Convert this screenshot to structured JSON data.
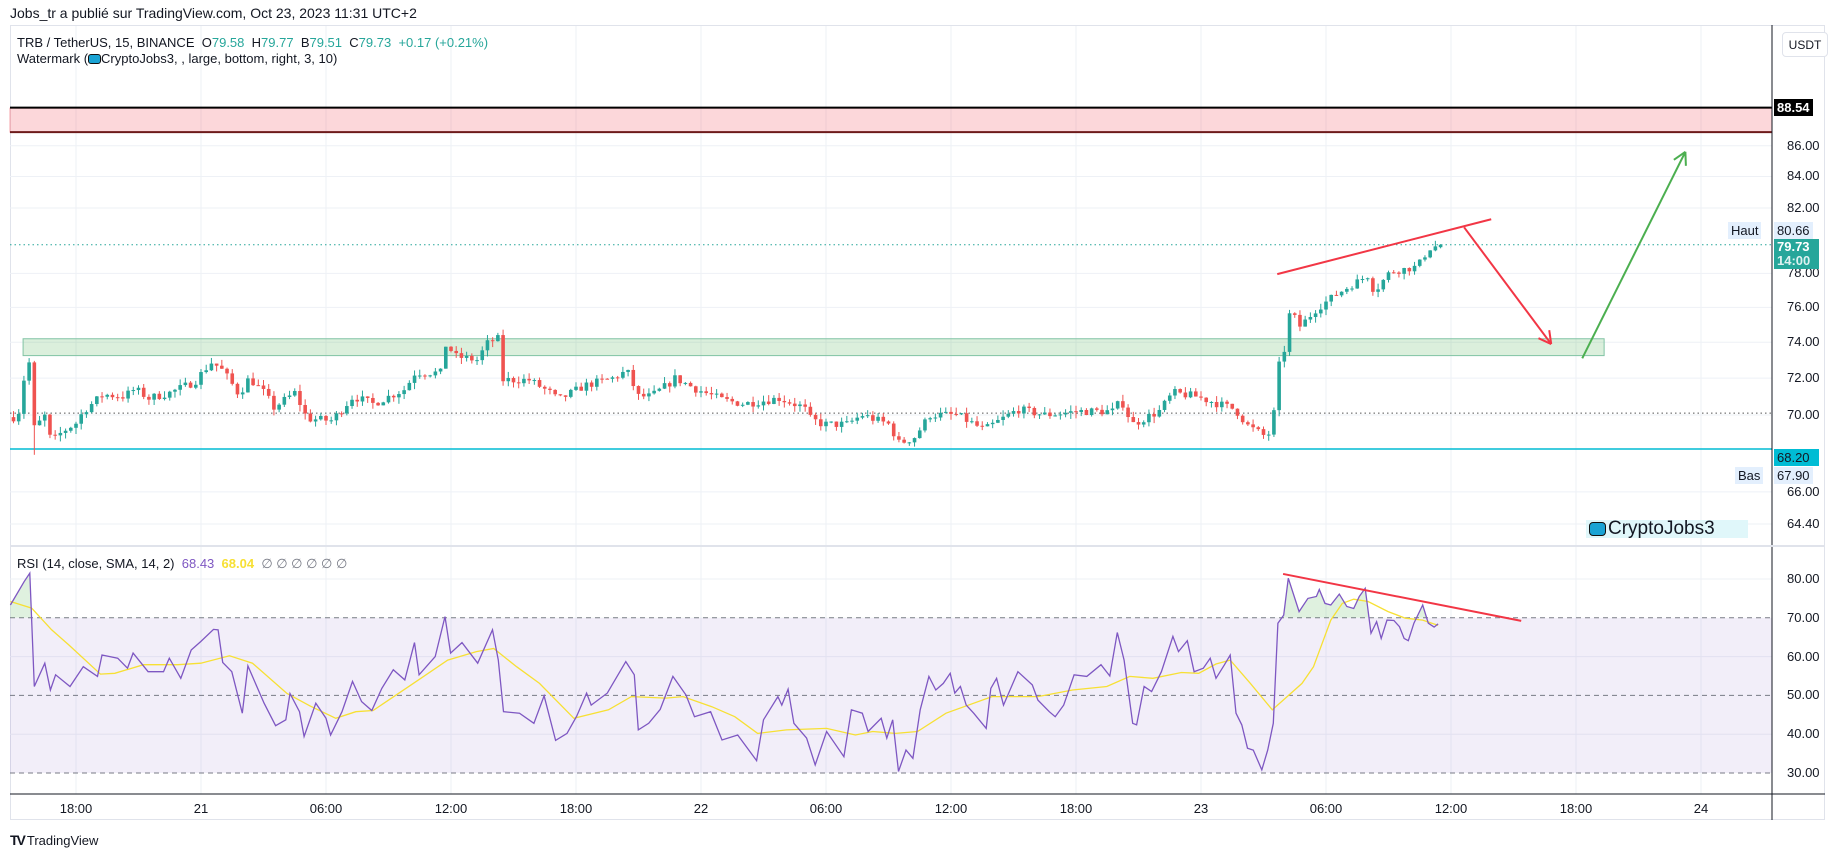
{
  "publisher": "Jobs_tr a publié sur TradingView.com, Oct 23, 2023 11:31 UTC+2",
  "legend": {
    "symbol": "TRB / TetherUS, 15, BINANCE",
    "o_label": "O",
    "open": "79.58",
    "h_label": "H",
    "high": "79.77",
    "l_label": "B",
    "low": "79.51",
    "c_label": "C",
    "close": "79.73",
    "change": "+0.17 (+0.21%)",
    "watermark_prefix": "Watermark (",
    "watermark_args": "CryptoJobs3, , large, bottom, right, 3, 10)"
  },
  "price_axis": {
    "currency": "USDT",
    "ticks": [
      "86.00",
      "84.00",
      "82.00",
      "78.00",
      "76.00",
      "74.00",
      "72.00",
      "70.00",
      "66.00",
      "64.40"
    ],
    "tick_values": [
      86,
      84,
      82,
      78,
      76,
      74,
      72,
      70,
      66,
      64.4
    ],
    "line_label": "88.54",
    "high_tag": "Haut",
    "high_value": "80.66",
    "last_price": "79.73",
    "countdown": "14:00",
    "support_label": "68.20",
    "low_tag": "Bas",
    "low_value": "67.90"
  },
  "rsi": {
    "title": "RSI (14, close, SMA, 14, 2)",
    "value": "68.43",
    "sma_value": "68.04",
    "empty_values": "∅ ∅ ∅ ∅ ∅ ∅",
    "ticks": [
      "80.00",
      "70.00",
      "60.00",
      "50.00",
      "40.00",
      "30.00"
    ],
    "tick_values": [
      80,
      70,
      60,
      50,
      40,
      30
    ]
  },
  "time_axis": {
    "ticks": [
      "18:00",
      "21",
      "06:00",
      "12:00",
      "18:00",
      "22",
      "06:00",
      "12:00",
      "18:00",
      "23",
      "06:00",
      "12:00",
      "18:00",
      "24"
    ]
  },
  "watermark": "CryptoJobs3",
  "footer": "TradingView",
  "colors": {
    "up": "#26a69a",
    "down": "#ef5350",
    "rsi": "#7e57c2",
    "sma": "#f7e034",
    "support": "#00bcd4",
    "drawing_red": "#f23645",
    "drawing_green": "#4caf50"
  },
  "chart_data": {
    "type": "candlestick",
    "interval_hours": 0.25,
    "time_unit": "hours since Oct 20 18:00",
    "time_range": [
      -3.0,
      65.5
    ],
    "last_candle": {
      "open": 79.58,
      "high": 79.77,
      "low": 79.51,
      "close": 79.73
    },
    "price_anchors": [
      [
        -3.07,
        69.8
      ],
      [
        -2.74,
        70.2
      ],
      [
        -2.45,
        72.3
      ],
      [
        -2.16,
        73.1
      ],
      [
        -1.97,
        68.6
      ],
      [
        -1.73,
        69.7
      ],
      [
        -1.44,
        70.0
      ],
      [
        -1.2,
        68.5
      ],
      [
        -0.67,
        69.1
      ],
      [
        0.05,
        69.6
      ],
      [
        0.34,
        70.2
      ],
      [
        1.3,
        71.1
      ],
      [
        2.3,
        71.0
      ],
      [
        2.83,
        71.4
      ],
      [
        3.5,
        70.9
      ],
      [
        4.51,
        71.2
      ],
      [
        5.71,
        71.8
      ],
      [
        6.05,
        72.3
      ],
      [
        6.53,
        72.9
      ],
      [
        7.06,
        72.4
      ],
      [
        7.83,
        71.1
      ],
      [
        8.31,
        72.0
      ],
      [
        9.03,
        71.2
      ],
      [
        9.5,
        70.4
      ],
      [
        10.51,
        71.2
      ],
      [
        11.09,
        69.8
      ],
      [
        12.29,
        69.7
      ],
      [
        13.3,
        71.0
      ],
      [
        14.26,
        70.6
      ],
      [
        15.8,
        71.4
      ],
      [
        16.27,
        72.3
      ],
      [
        17.52,
        72.3
      ],
      [
        17.76,
        73.9
      ],
      [
        18.24,
        73.2
      ],
      [
        19.25,
        73.0
      ],
      [
        19.78,
        74.0
      ],
      [
        20.26,
        74.2
      ],
      [
        20.5,
        71.9
      ],
      [
        21.75,
        71.9
      ],
      [
        22.76,
        71.2
      ],
      [
        23.14,
        70.8
      ],
      [
        24.44,
        71.6
      ],
      [
        25.78,
        72.0
      ],
      [
        26.45,
        72.4
      ],
      [
        26.98,
        71.0
      ],
      [
        27.6,
        71.0
      ],
      [
        28.47,
        71.7
      ],
      [
        28.76,
        72.0
      ],
      [
        29.77,
        71.4
      ],
      [
        31.06,
        70.8
      ],
      [
        32.07,
        70.6
      ],
      [
        33.75,
        70.9
      ],
      [
        34.95,
        70.4
      ],
      [
        35.24,
        69.8
      ],
      [
        35.86,
        69.5
      ],
      [
        37.01,
        69.5
      ],
      [
        37.73,
        70.0
      ],
      [
        39.03,
        69.5
      ],
      [
        39.51,
        68.5
      ],
      [
        40.23,
        68.8
      ],
      [
        41.0,
        70.0
      ],
      [
        42.29,
        70.0
      ],
      [
        43.59,
        69.2
      ],
      [
        45.22,
        70.3
      ],
      [
        46.52,
        70.0
      ],
      [
        48.2,
        70.2
      ],
      [
        49.78,
        70.2
      ],
      [
        50.17,
        70.8
      ],
      [
        50.7,
        69.5
      ],
      [
        51.99,
        70.2
      ],
      [
        52.66,
        71.2
      ],
      [
        53.77,
        71.0
      ],
      [
        55.64,
        70.3
      ],
      [
        56.27,
        69.4
      ],
      [
        57.18,
        68.8
      ],
      [
        57.46,
        69.6
      ],
      [
        57.7,
        72.6
      ],
      [
        57.94,
        73.1
      ],
      [
        58.28,
        75.8
      ],
      [
        58.76,
        74.9
      ],
      [
        59.53,
        75.9
      ],
      [
        60.54,
        76.8
      ],
      [
        62.03,
        77.9
      ],
      [
        62.31,
        76.9
      ],
      [
        63.08,
        78.1
      ],
      [
        64.38,
        78.4
      ],
      [
        64.95,
        79.5
      ],
      [
        65.5,
        79.73
      ]
    ],
    "rsi_series": [
      [
        -3.15,
        73.3
      ],
      [
        -2.49,
        79.3
      ],
      [
        -2.22,
        81.5
      ],
      [
        -2.0,
        52.3
      ],
      [
        -1.5,
        58.3
      ],
      [
        -1.23,
        51.4
      ],
      [
        -0.98,
        55.3
      ],
      [
        -0.29,
        52.3
      ],
      [
        0.35,
        57.4
      ],
      [
        1.03,
        54.9
      ],
      [
        1.25,
        60.4
      ],
      [
        2.0,
        59.6
      ],
      [
        2.47,
        57.0
      ],
      [
        2.74,
        60.9
      ],
      [
        3.46,
        56.1
      ],
      [
        4.2,
        56.1
      ],
      [
        4.48,
        59.6
      ],
      [
        5.03,
        54.4
      ],
      [
        5.53,
        61.7
      ],
      [
        5.99,
        63.9
      ],
      [
        6.6,
        67.0
      ],
      [
        6.82,
        66.9
      ],
      [
        7.04,
        58.5
      ],
      [
        7.48,
        56.1
      ],
      [
        7.98,
        45.4
      ],
      [
        8.25,
        57.6
      ],
      [
        9.03,
        48.0
      ],
      [
        9.58,
        42.2
      ],
      [
        10.07,
        43.7
      ],
      [
        10.27,
        50.5
      ],
      [
        10.73,
        45.8
      ],
      [
        10.95,
        39.4
      ],
      [
        11.51,
        48.0
      ],
      [
        12.0,
        44.1
      ],
      [
        12.22,
        39.8
      ],
      [
        12.77,
        45.8
      ],
      [
        13.27,
        53.6
      ],
      [
        13.71,
        48.4
      ],
      [
        14.2,
        46.1
      ],
      [
        14.68,
        51.8
      ],
      [
        15.23,
        56.6
      ],
      [
        15.78,
        54.0
      ],
      [
        16.25,
        63.6
      ],
      [
        16.47,
        55.3
      ],
      [
        17.24,
        60.0
      ],
      [
        17.71,
        70.3
      ],
      [
        17.98,
        60.9
      ],
      [
        18.53,
        63.6
      ],
      [
        19.28,
        58.3
      ],
      [
        19.99,
        66.9
      ],
      [
        20.27,
        59.1
      ],
      [
        20.52,
        45.8
      ],
      [
        21.29,
        45.4
      ],
      [
        21.98,
        42.8
      ],
      [
        22.47,
        49.9
      ],
      [
        23.02,
        38.4
      ],
      [
        23.57,
        40.2
      ],
      [
        24.04,
        44.7
      ],
      [
        24.51,
        50.6
      ],
      [
        24.73,
        47.5
      ],
      [
        25.5,
        50.6
      ],
      [
        26.39,
        58.7
      ],
      [
        26.8,
        55.3
      ],
      [
        26.99,
        41.1
      ],
      [
        27.49,
        42.8
      ],
      [
        28.04,
        46.4
      ],
      [
        28.65,
        54.9
      ],
      [
        29.28,
        50.1
      ],
      [
        29.69,
        44.5
      ],
      [
        30.46,
        45.8
      ],
      [
        31.01,
        38.5
      ],
      [
        31.76,
        39.8
      ],
      [
        32.67,
        33.2
      ],
      [
        33.0,
        43.7
      ],
      [
        33.69,
        49.7
      ],
      [
        33.88,
        47.5
      ],
      [
        34.18,
        51.6
      ],
      [
        34.46,
        42.8
      ],
      [
        35.07,
        39.0
      ],
      [
        35.48,
        32.1
      ],
      [
        36.03,
        40.7
      ],
      [
        36.86,
        34.2
      ],
      [
        37.22,
        46.3
      ],
      [
        37.74,
        45.4
      ],
      [
        38.02,
        40.7
      ],
      [
        38.65,
        44.1
      ],
      [
        38.92,
        39.0
      ],
      [
        39.2,
        43.7
      ],
      [
        39.48,
        30.4
      ],
      [
        39.84,
        35.9
      ],
      [
        40.17,
        33.8
      ],
      [
        40.52,
        46.3
      ],
      [
        40.94,
        54.9
      ],
      [
        41.27,
        51.4
      ],
      [
        41.63,
        53.1
      ],
      [
        41.96,
        55.7
      ],
      [
        42.18,
        50.6
      ],
      [
        42.45,
        52.3
      ],
      [
        42.73,
        47.5
      ],
      [
        43.09,
        45.4
      ],
      [
        43.69,
        41.5
      ],
      [
        43.91,
        51.8
      ],
      [
        44.19,
        54.4
      ],
      [
        44.52,
        47.5
      ],
      [
        45.21,
        56.1
      ],
      [
        45.9,
        52.7
      ],
      [
        46.17,
        48.8
      ],
      [
        46.72,
        45.8
      ],
      [
        47.0,
        44.5
      ],
      [
        47.41,
        47.5
      ],
      [
        47.91,
        55.3
      ],
      [
        48.52,
        54.9
      ],
      [
        49.2,
        57.9
      ],
      [
        49.62,
        55.0
      ],
      [
        49.98,
        66.2
      ],
      [
        50.31,
        59.1
      ],
      [
        50.72,
        42.8
      ],
      [
        50.91,
        42.4
      ],
      [
        51.27,
        52.3
      ],
      [
        51.63,
        51.0
      ],
      [
        52.1,
        56.1
      ],
      [
        52.65,
        65.2
      ],
      [
        52.92,
        61.3
      ],
      [
        53.34,
        64.1
      ],
      [
        53.67,
        56.1
      ],
      [
        54.11,
        57.0
      ],
      [
        54.44,
        59.6
      ],
      [
        54.72,
        54.4
      ],
      [
        55.13,
        57.9
      ],
      [
        55.4,
        60.4
      ],
      [
        55.68,
        45.4
      ],
      [
        55.96,
        42.4
      ],
      [
        56.23,
        36.4
      ],
      [
        56.51,
        35.9
      ],
      [
        56.92,
        30.8
      ],
      [
        57.2,
        35.9
      ],
      [
        57.47,
        42.8
      ],
      [
        57.69,
        68.6
      ],
      [
        57.97,
        70.7
      ],
      [
        58.19,
        80.2
      ],
      [
        58.71,
        71.6
      ],
      [
        59.13,
        75.0
      ],
      [
        59.54,
        75.5
      ],
      [
        59.68,
        77.3
      ],
      [
        59.95,
        73.7
      ],
      [
        60.23,
        73.3
      ],
      [
        60.64,
        76.1
      ],
      [
        61.0,
        72.9
      ],
      [
        61.33,
        72.4
      ],
      [
        61.6,
        75.5
      ],
      [
        61.88,
        77.6
      ],
      [
        62.16,
        66.0
      ],
      [
        62.43,
        69.0
      ],
      [
        62.65,
        64.7
      ],
      [
        62.93,
        69.4
      ],
      [
        63.26,
        69.3
      ],
      [
        63.53,
        67.7
      ],
      [
        63.75,
        64.7
      ],
      [
        63.95,
        64.1
      ],
      [
        64.22,
        68.6
      ],
      [
        64.64,
        73.3
      ],
      [
        64.91,
        68.6
      ],
      [
        65.19,
        67.6
      ],
      [
        65.38,
        68.43
      ]
    ],
    "rsi_sma_series": [
      [
        -3.15,
        74.2
      ],
      [
        -2.13,
        72.5
      ],
      [
        -1.17,
        66.9
      ],
      [
        -0.34,
        63.0
      ],
      [
        1.17,
        55.5
      ],
      [
        1.86,
        55.7
      ],
      [
        3.24,
        57.9
      ],
      [
        4.89,
        57.9
      ],
      [
        5.99,
        58.3
      ],
      [
        7.37,
        60.2
      ],
      [
        8.47,
        58.3
      ],
      [
        10.13,
        50.5
      ],
      [
        11.23,
        47.3
      ],
      [
        12.47,
        44.1
      ],
      [
        13.43,
        45.8
      ],
      [
        14.26,
        46.1
      ],
      [
        16.19,
        53.1
      ],
      [
        17.84,
        59.1
      ],
      [
        19.22,
        61.3
      ],
      [
        20.05,
        62.1
      ],
      [
        21.15,
        57.4
      ],
      [
        22.25,
        53.1
      ],
      [
        23.9,
        44.1
      ],
      [
        25.56,
        46.3
      ],
      [
        26.66,
        49.7
      ],
      [
        28.31,
        49.3
      ],
      [
        29.14,
        49.7
      ],
      [
        30.52,
        47.1
      ],
      [
        31.62,
        44.5
      ],
      [
        32.72,
        40.2
      ],
      [
        34.1,
        41.1
      ],
      [
        36.03,
        41.5
      ],
      [
        37.41,
        39.8
      ],
      [
        38.24,
        40.7
      ],
      [
        39.34,
        40.2
      ],
      [
        40.39,
        40.7
      ],
      [
        41.76,
        45.4
      ],
      [
        43.97,
        49.7
      ],
      [
        46.17,
        49.7
      ],
      [
        47.83,
        51.4
      ],
      [
        49.48,
        52.3
      ],
      [
        50.58,
        54.9
      ],
      [
        51.69,
        54.4
      ],
      [
        53.06,
        55.9
      ],
      [
        53.89,
        55.7
      ],
      [
        54.72,
        58.1
      ],
      [
        55.4,
        59.1
      ],
      [
        56.37,
        53.1
      ],
      [
        57.42,
        46.3
      ],
      [
        58.85,
        53.1
      ],
      [
        59.4,
        57.4
      ],
      [
        60.23,
        69.4
      ],
      [
        60.78,
        73.7
      ],
      [
        61.33,
        74.8
      ],
      [
        62.02,
        74.2
      ],
      [
        62.98,
        71.6
      ],
      [
        63.81,
        69.9
      ],
      [
        64.64,
        69.4
      ],
      [
        65.19,
        68.4
      ],
      [
        65.38,
        68.04
      ]
    ],
    "levels": {
      "resistance_line": 88.54,
      "resistance_zone": [
        86.9,
        88.5
      ],
      "support_line": 68.2,
      "reference_dotted": 70.1,
      "rsi_bands": [
        70,
        50,
        30
      ]
    },
    "drawings": {
      "support_zone": {
        "t": [
          -2.54,
          73.35
        ],
        "p": [
          73.25,
          74.2
        ]
      },
      "rising_trendline": [
        [
          57.66,
          77.96
        ],
        [
          67.93,
          81.3
        ]
      ],
      "down_arrow": [
        [
          66.63,
          80.8
        ],
        [
          70.81,
          73.9
        ]
      ],
      "up_arrow": [
        [
          72.3,
          73.1
        ],
        [
          77.25,
          85.6
        ]
      ],
      "rsi_trendline": [
        [
          57.94,
          81.3
        ],
        [
          69.37,
          69.2
        ]
      ]
    }
  }
}
